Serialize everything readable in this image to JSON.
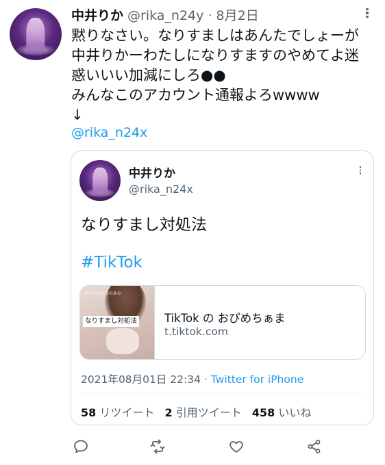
{
  "tweet": {
    "author_name": "中井りか",
    "author_handle": "@rika_n24y",
    "separator": "·",
    "date": "8月2日",
    "text": "黙りなさい。なりすましはあんたでしょーが\n中井りかーわたしになりすますのやめてよ迷\n惑いいい加減にしろ●●\nみんなこのアカウント通報よろwwww\n↓",
    "mention": "@rika_n24x"
  },
  "quoted_tweet": {
    "author_name": "中井りか",
    "author_handle": "@rika_n24x",
    "text": "なりすまし対処法",
    "hashtag": "#TikTok",
    "card": {
      "thumb_caption": "なりすまし対処法",
      "thumb_top_text": "ボインとなるのあみ",
      "title": "TikTok の おぴめちぁま",
      "domain": "t.tiktok.com"
    },
    "timestamp": "2021年08月01日 22:34",
    "meta_separator": " · ",
    "source": "Twitter for iPhone",
    "stats": {
      "retweets_count": "58",
      "retweets_label": "リツイート",
      "quotes_count": "2",
      "quotes_label": "引用ツイート",
      "likes_count": "458",
      "likes_label": "いいね"
    }
  },
  "actions": [
    "reply-icon",
    "retweet-icon",
    "like-icon",
    "share-icon"
  ],
  "colors": {
    "link": "#1d9bf0",
    "secondary": "#536471",
    "border": "#cfd9de"
  }
}
